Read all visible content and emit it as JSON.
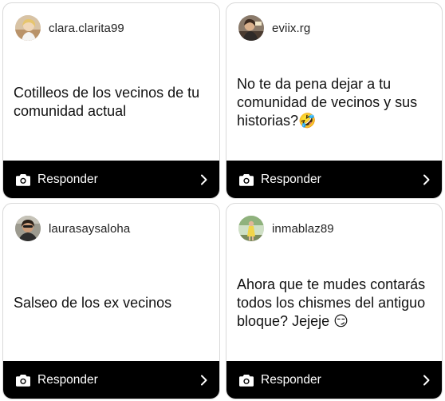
{
  "theme": {
    "reply_bar_color": "#000000",
    "card_border_color": "#d9d9d9",
    "background": "#ffffff"
  },
  "cards": [
    {
      "username": "clara.clarita99",
      "question": "Cotilleos de los vecinos de tu comunidad actual",
      "reply_label": "Responder",
      "avatar_icon": "user-photo-avatar"
    },
    {
      "username": "eviix.rg",
      "question": "No te da pena dejar a tu comunidad de vecinos y sus historias?🤣",
      "reply_label": "Responder",
      "avatar_icon": "user-photo-avatar"
    },
    {
      "username": "laurasaysaloha",
      "question": "Salseo de los ex vecinos",
      "reply_label": "Responder",
      "avatar_icon": "user-photo-avatar"
    },
    {
      "username": "inmablaz89",
      "question": "Ahora que te mudes contarás todos los chismes del antiguo bloque? Jejeje 😏",
      "reply_label": "Responder",
      "avatar_icon": "user-photo-avatar"
    }
  ]
}
